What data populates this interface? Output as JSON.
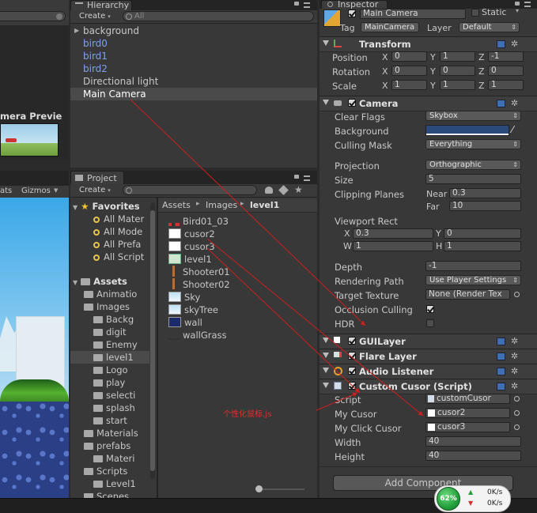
{
  "colors": {
    "accent_blue": "#7aa3e8",
    "background_swatch": "#2a4a7c",
    "arrow_red": "#cc1f1f",
    "annotation_red": "#e03030",
    "net_green": "#22a03a"
  },
  "scene_preview": {
    "title": "mera Previe"
  },
  "game_view": {
    "stats_label": "ats",
    "gizmos_label": "Gizmos"
  },
  "hierarchy": {
    "tab_label": "Hierarchy",
    "create_label": "Create",
    "search_placeholder": "All",
    "items": [
      {
        "label": "background",
        "style": "normal",
        "expanded": false
      },
      {
        "label": "bird0",
        "style": "prefab"
      },
      {
        "label": "bird1",
        "style": "prefab"
      },
      {
        "label": "bird2",
        "style": "prefab"
      },
      {
        "label": "Directional light",
        "style": "normal"
      },
      {
        "label": "Main Camera",
        "style": "selected"
      }
    ]
  },
  "project": {
    "tab_label": "Project",
    "create_label": "Create",
    "favorites_label": "Favorites",
    "favorites": [
      "All Mater",
      "All Mode",
      "All Prefa",
      "All Script"
    ],
    "assets_label": "Assets",
    "tree": [
      {
        "label": "Animatio",
        "depth": 1
      },
      {
        "label": "Images",
        "depth": 1
      },
      {
        "label": "Backg",
        "depth": 2
      },
      {
        "label": "digit",
        "depth": 2
      },
      {
        "label": "Enemy",
        "depth": 2
      },
      {
        "label": "level1",
        "depth": 2,
        "selected": true
      },
      {
        "label": "Logo",
        "depth": 2
      },
      {
        "label": "play",
        "depth": 2
      },
      {
        "label": "selecti",
        "depth": 2
      },
      {
        "label": "splash",
        "depth": 2
      },
      {
        "label": "start",
        "depth": 2
      },
      {
        "label": "Materials",
        "depth": 1
      },
      {
        "label": "prefabs",
        "depth": 1
      },
      {
        "label": "Materi",
        "depth": 2
      },
      {
        "label": "Scripts",
        "depth": 1
      },
      {
        "label": "Level1",
        "depth": 2
      },
      {
        "label": "Scenes",
        "depth": 1
      }
    ],
    "breadcrumb": [
      "Assets",
      "Images",
      "level1"
    ],
    "assets": [
      {
        "label": "Bird01_03",
        "icon": "sprite-icon"
      },
      {
        "label": "cusor2",
        "icon": "cursor-icon"
      },
      {
        "label": "cusor3",
        "icon": "cursor-icon"
      },
      {
        "label": "level1",
        "icon": "script-icon"
      },
      {
        "label": "Shooter01",
        "icon": "stick-icon"
      },
      {
        "label": "Shooter02",
        "icon": "stick-icon"
      },
      {
        "label": "Sky",
        "icon": "image-icon"
      },
      {
        "label": "skyTree",
        "icon": "image-icon"
      },
      {
        "label": "wall",
        "icon": "image-icon"
      },
      {
        "label": "wallGrass",
        "icon": "image-icon"
      }
    ]
  },
  "inspector": {
    "tab_label": "Inspector",
    "object_name": "Main Camera",
    "static_label": "Static",
    "tag_label": "Tag",
    "tag_value": "MainCamera",
    "layer_label": "Layer",
    "layer_value": "Default",
    "transform": {
      "name": "Transform",
      "position": {
        "label": "Position",
        "x": "0",
        "y": "1",
        "z": "-1"
      },
      "rotation": {
        "label": "Rotation",
        "x": "0",
        "y": "0",
        "z": "0"
      },
      "scale": {
        "label": "Scale",
        "x": "1",
        "y": "1",
        "z": "1"
      }
    },
    "camera": {
      "name": "Camera",
      "clear_flags_label": "Clear Flags",
      "clear_flags": "Skybox",
      "background_label": "Background",
      "culling_mask_label": "Culling Mask",
      "culling_mask": "Everything",
      "projection_label": "Projection",
      "projection": "Orthographic",
      "size_label": "Size",
      "size": "5",
      "clipping_label": "Clipping Planes",
      "near_label": "Near",
      "near": "0.3",
      "far_label": "Far",
      "far": "10",
      "viewport_label": "Viewport Rect",
      "vx": "0.3",
      "vy": "0",
      "vw": "1",
      "vh": "1",
      "depth_label": "Depth",
      "depth": "-1",
      "rendering_path_label": "Rendering Path",
      "rendering_path": "Use Player Settings",
      "target_texture_label": "Target Texture",
      "target_texture": "None (Render Tex",
      "occlusion_label": "Occlusion Culling",
      "hdr_label": "HDR"
    },
    "gui_layer": "GUILayer",
    "flare_layer": "Flare Layer",
    "audio_listener": "Audio Listener",
    "custom_cursor": {
      "name": "Custom Cusor (Script)",
      "script_label": "Script",
      "script": "customCusor",
      "my_cursor_label": "My Cusor",
      "my_cursor": "cusor2",
      "my_click_label": "My Click Cusor",
      "my_click": "cusor3",
      "width_label": "Width",
      "width": "40",
      "height_label": "Height",
      "height": "40"
    },
    "add_component": "Add Component"
  },
  "annotation": "个性化鼠标.js",
  "net_widget": {
    "percent": "62%",
    "up": "0K/s",
    "down": "0K/s"
  }
}
